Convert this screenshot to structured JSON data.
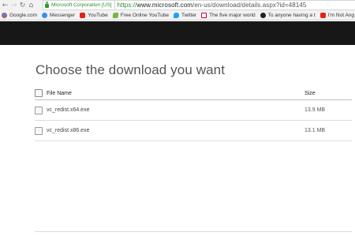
{
  "browser": {
    "secure_label": "Microsoft Corporation [US]",
    "url_scheme": "https://",
    "url_host": "www.microsoft.com",
    "url_path": "/en-us/download/details.aspx?id=48145",
    "bookmarks": [
      {
        "label": "Google.com",
        "icon": "google-icon"
      },
      {
        "label": "Messenger",
        "icon": "messenger-icon"
      },
      {
        "label": "YouTube",
        "icon": "youtube-icon"
      },
      {
        "label": "Free Online YouTube",
        "icon": "leaf-icon"
      },
      {
        "label": "Twitter",
        "icon": "twitter-icon"
      },
      {
        "label": "The five major world",
        "icon": "news-icon"
      },
      {
        "label": "To anyone having a t",
        "icon": "swirl-icon"
      },
      {
        "label": "I'm Not Ang",
        "icon": "youtube-icon"
      }
    ]
  },
  "page": {
    "title": "Choose the download you want",
    "columns": {
      "name": "File Name",
      "size": "Size"
    },
    "files": [
      {
        "name": "vc_redist.x64.exe",
        "size": "13.9 MB"
      },
      {
        "name": "vc_redist.x86.exe",
        "size": "13.1 MB"
      }
    ]
  }
}
